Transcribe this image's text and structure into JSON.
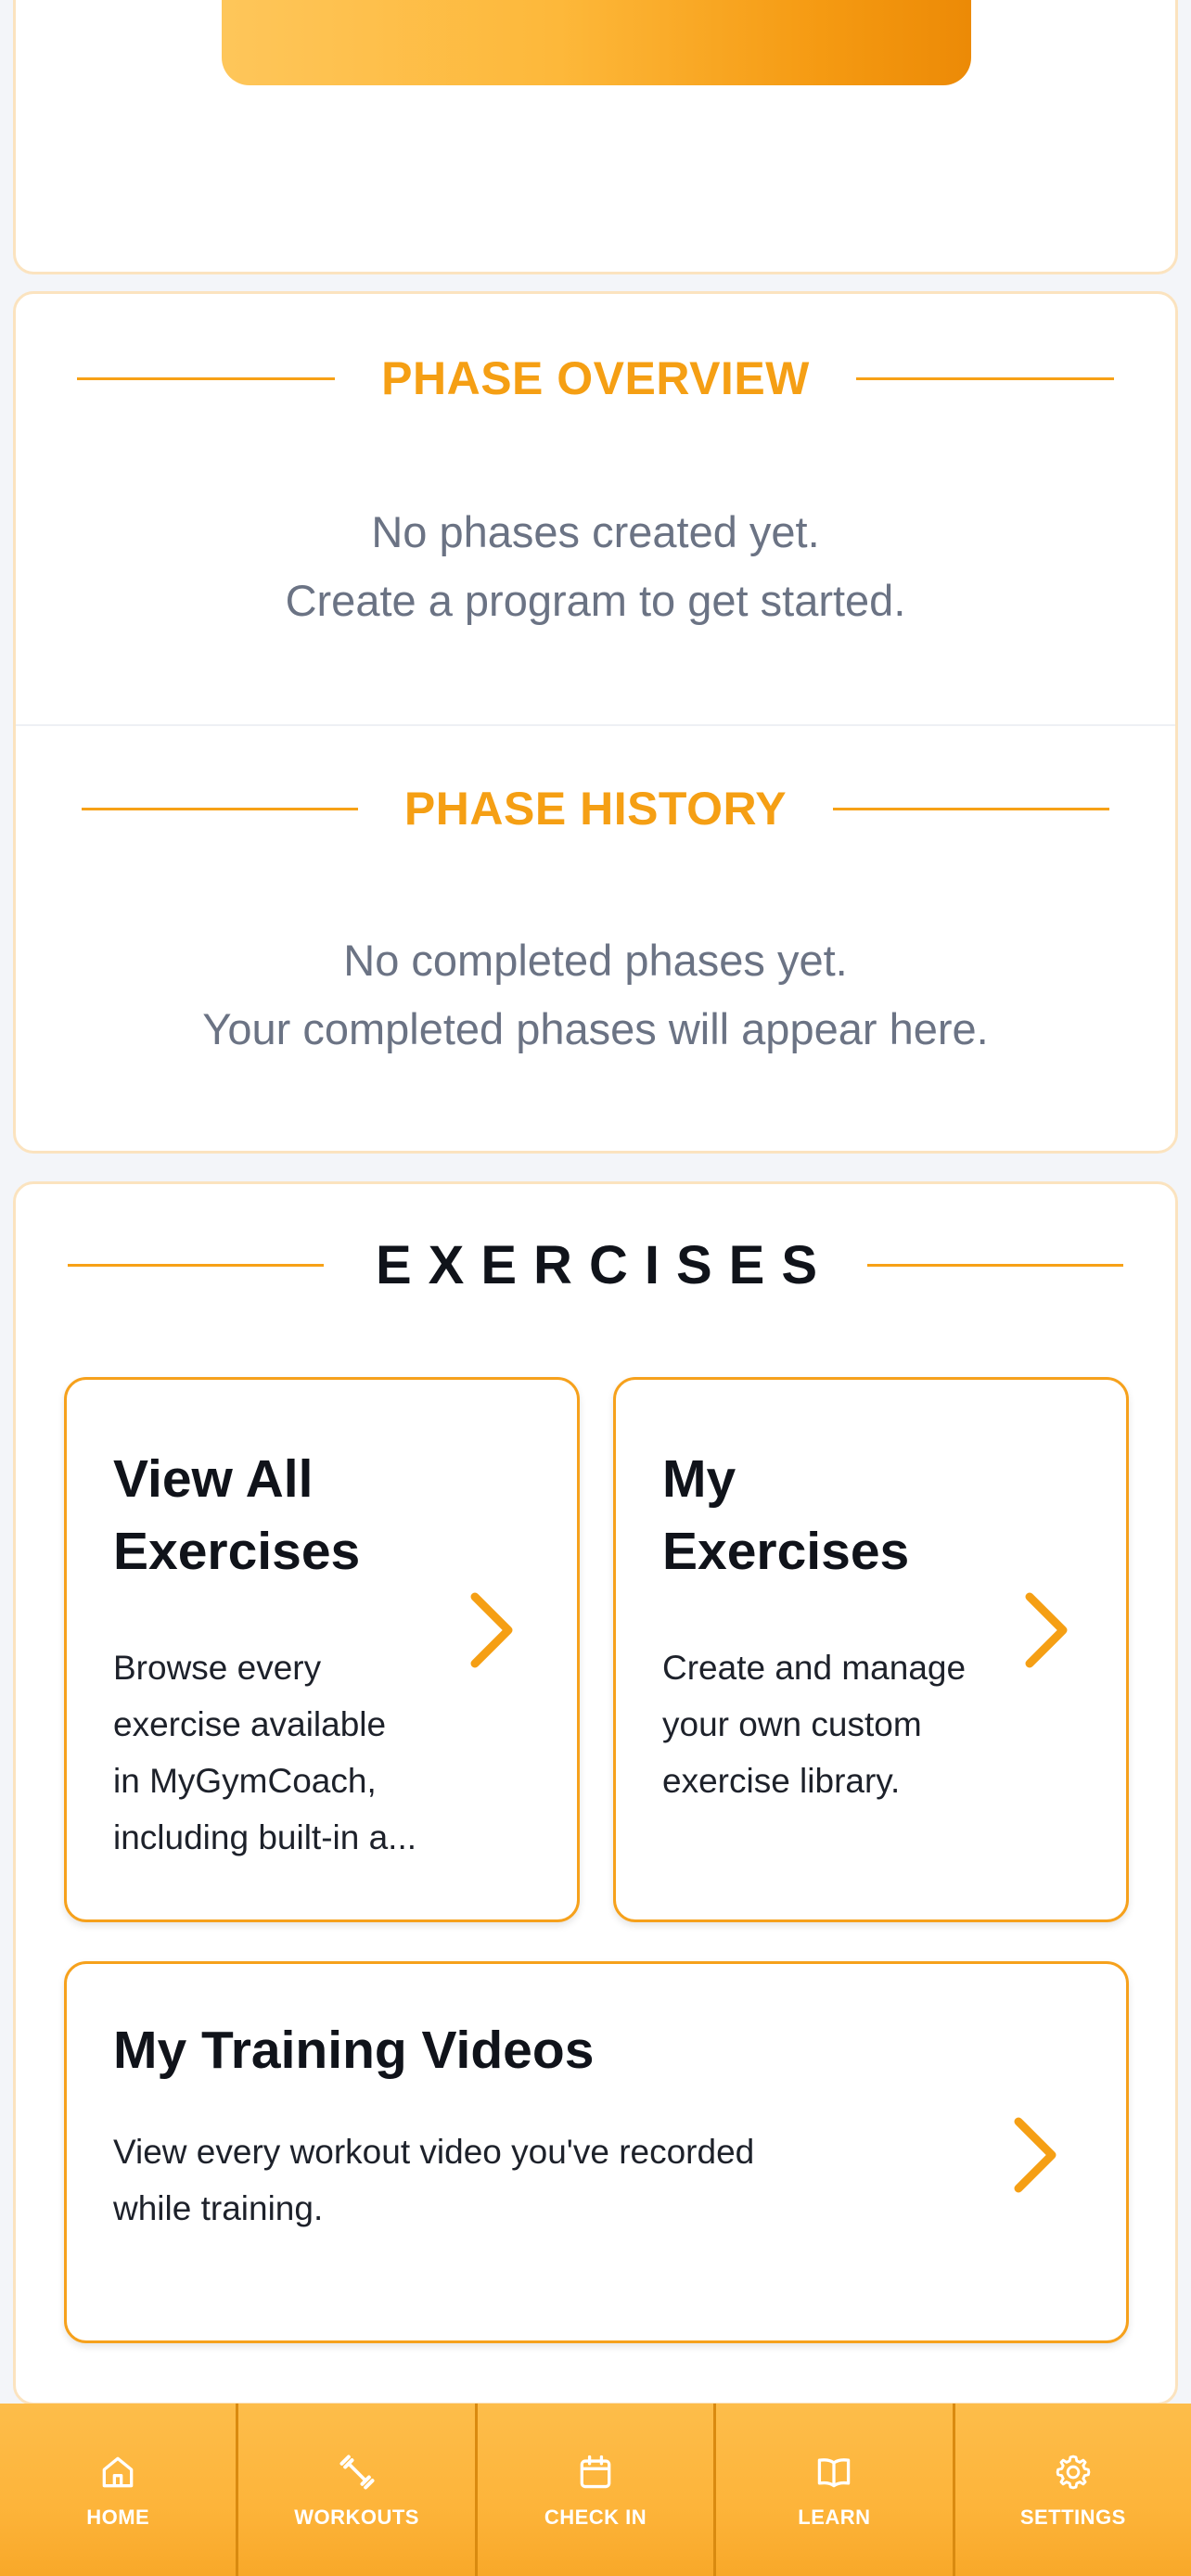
{
  "phase_overview": {
    "title": "PHASE OVERVIEW",
    "empty_line1": "No phases created yet.",
    "empty_line2": "Create a program to get started."
  },
  "phase_history": {
    "title": "PHASE HISTORY",
    "empty_line1": "No completed phases yet.",
    "empty_line2": "Your completed phases will appear here."
  },
  "exercises": {
    "title": "EXERCISES",
    "view_all": {
      "title_line1": "View All",
      "title_line2": "Exercises",
      "desc_line1": "Browse every",
      "desc_line2": "exercise available",
      "desc_line3": "in MyGymCoach,",
      "desc_line4": "including built-in a..."
    },
    "my_exercises": {
      "title_line1": "My",
      "title_line2": "Exercises",
      "desc_line1": "Create and manage",
      "desc_line2": "your own custom",
      "desc_line3": "exercise library."
    },
    "training_videos": {
      "title": "My Training Videos",
      "desc_line1": "View every workout video you've recorded",
      "desc_line2": "while training."
    }
  },
  "nav": {
    "home": {
      "label": "HOME",
      "icon": "home-icon"
    },
    "workouts": {
      "label": "WORKOUTS",
      "icon": "dumbbell-icon"
    },
    "check_in": {
      "label": "CHECK IN",
      "icon": "calendar-icon"
    },
    "learn": {
      "label": "LEARN",
      "icon": "book-icon"
    },
    "settings": {
      "label": "SETTINGS",
      "icon": "gear-icon"
    }
  },
  "colors": {
    "accent": "#f59f14",
    "card_border": "#fbe3bf",
    "muted_text": "#6b7384",
    "nav_bg": "#fdb83a"
  }
}
